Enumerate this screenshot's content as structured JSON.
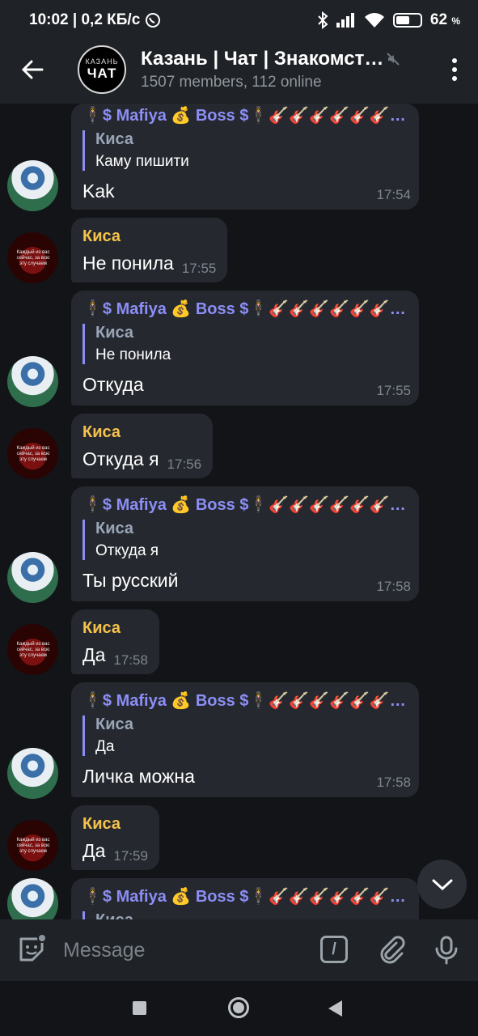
{
  "status_bar": {
    "time_and_speed": "10:02 | 0,2 КБ/с",
    "battery": "62",
    "battery_unit": "%",
    "battery_level": 0.62
  },
  "header": {
    "avatar_top": "КАЗАНЬ",
    "avatar_bottom": "ЧАТ",
    "title": "Казань | Чат | Знакомст…",
    "subtitle": "1507 members, 112 online"
  },
  "messages": [
    {
      "sender": "🕴$ Mafiya 💰 Boss $🕴🎸🎸🎸🎸🎸🎸…",
      "sender_type": "boss",
      "reply_name": "Киса",
      "reply_text": "Каму пишити",
      "text": "Kak",
      "time": "17:54"
    },
    {
      "sender": "Киса",
      "sender_type": "kisa",
      "text": "Не понила",
      "time": "17:55"
    },
    {
      "sender": "🕴$ Mafiya 💰 Boss $🕴🎸🎸🎸🎸🎸🎸…",
      "sender_type": "boss",
      "reply_name": "Киса",
      "reply_text": "Не понила",
      "text": "Откуда",
      "time": "17:55"
    },
    {
      "sender": "Киса",
      "sender_type": "kisa",
      "text": "Откуда я",
      "time": "17:56"
    },
    {
      "sender": "🕴$ Mafiya 💰 Boss $🕴🎸🎸🎸🎸🎸🎸…",
      "sender_type": "boss",
      "reply_name": "Киса",
      "reply_text": "Откуда я",
      "text": "Ты русский",
      "time": "17:58"
    },
    {
      "sender": "Киса",
      "sender_type": "kisa",
      "text": "Да",
      "time": "17:58"
    },
    {
      "sender": "🕴$ Mafiya 💰 Boss $🕴🎸🎸🎸🎸🎸🎸…",
      "sender_type": "boss",
      "reply_name": "Киса",
      "reply_text": "Да",
      "text": "Личка можна",
      "time": "17:58"
    },
    {
      "sender": "Киса",
      "sender_type": "kisa",
      "text": "Да",
      "time": "17:59"
    },
    {
      "sender": "🕴$ Mafiya 💰 Boss $🕴🎸🎸🎸🎸🎸🎸…",
      "sender_type": "boss",
      "reply_name": "Киса",
      "reply_text": "",
      "text": "",
      "time": ""
    }
  ],
  "kisa_avatar_text": "Каждый из вас сейчас, за всю эту случаем",
  "input": {
    "placeholder": "Message",
    "command_label": "/"
  },
  "colors": {
    "boss_name": "#8c8ef5",
    "kisa_name": "#f5c24b",
    "bubble": "#25292f",
    "background": "#121418"
  },
  "icons": [
    "back-arrow-icon",
    "mute-icon",
    "more-vertical-icon",
    "chevron-down-icon",
    "sticker-icon",
    "attach-icon",
    "mic-icon"
  ]
}
